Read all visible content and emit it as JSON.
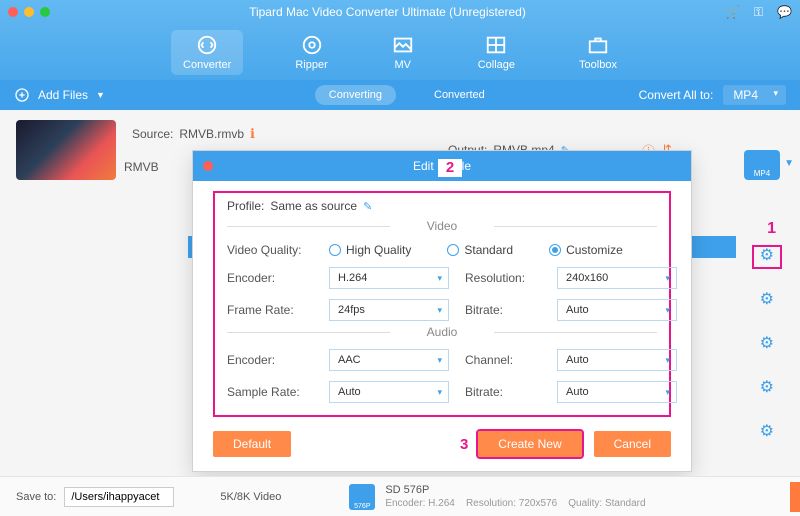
{
  "window": {
    "title": "Tipard Mac Video Converter Ultimate (Unregistered)"
  },
  "nav": {
    "tabs": [
      "Converter",
      "Ripper",
      "MV",
      "Collage",
      "Toolbox"
    ],
    "active": "Converter"
  },
  "toolbar": {
    "add_files": "Add Files",
    "converting": "Converting",
    "converted": "Converted",
    "convert_all_label": "Convert All to:",
    "convert_all_value": "MP4"
  },
  "item": {
    "source_label": "Source:",
    "source_file": "RMVB.rmvb",
    "name": "RMVB",
    "output_label": "Output:",
    "output_file": "RMVB.mp4",
    "format_badge": "MP4"
  },
  "modal": {
    "title": "Edit Profile",
    "profile_label": "Profile:",
    "profile_value": "Same as source",
    "section_video": "Video",
    "section_audio": "Audio",
    "video_quality_label": "Video Quality:",
    "quality_options": {
      "high": "High Quality",
      "standard": "Standard",
      "customize": "Customize"
    },
    "quality_selected": "customize",
    "video": {
      "encoder_label": "Encoder:",
      "encoder": "H.264",
      "resolution_label": "Resolution:",
      "resolution": "240x160",
      "framerate_label": "Frame Rate:",
      "framerate": "24fps",
      "bitrate_label": "Bitrate:",
      "bitrate": "Auto"
    },
    "audio": {
      "encoder_label": "Encoder:",
      "encoder": "AAC",
      "channel_label": "Channel:",
      "channel": "Auto",
      "samplerate_label": "Sample Rate:",
      "samplerate": "Auto",
      "bitrate_label": "Bitrate:",
      "bitrate": "Auto"
    },
    "buttons": {
      "default": "Default",
      "create_new": "Create New",
      "cancel": "Cancel"
    }
  },
  "footer": {
    "save_to_label": "Save to:",
    "save_to_path": "/Users/ihappyacet",
    "side_category": "5K/8K Video",
    "preset_name": "SD 576P",
    "preset_encoder_label": "Encoder:",
    "preset_encoder": "H.264",
    "preset_res_label": "Resolution:",
    "preset_res": "720x576",
    "preset_quality_label": "Quality:",
    "preset_quality": "Standard",
    "sd_badge": "576P"
  },
  "annotations": {
    "one": "1",
    "two": "2",
    "three": "3"
  }
}
